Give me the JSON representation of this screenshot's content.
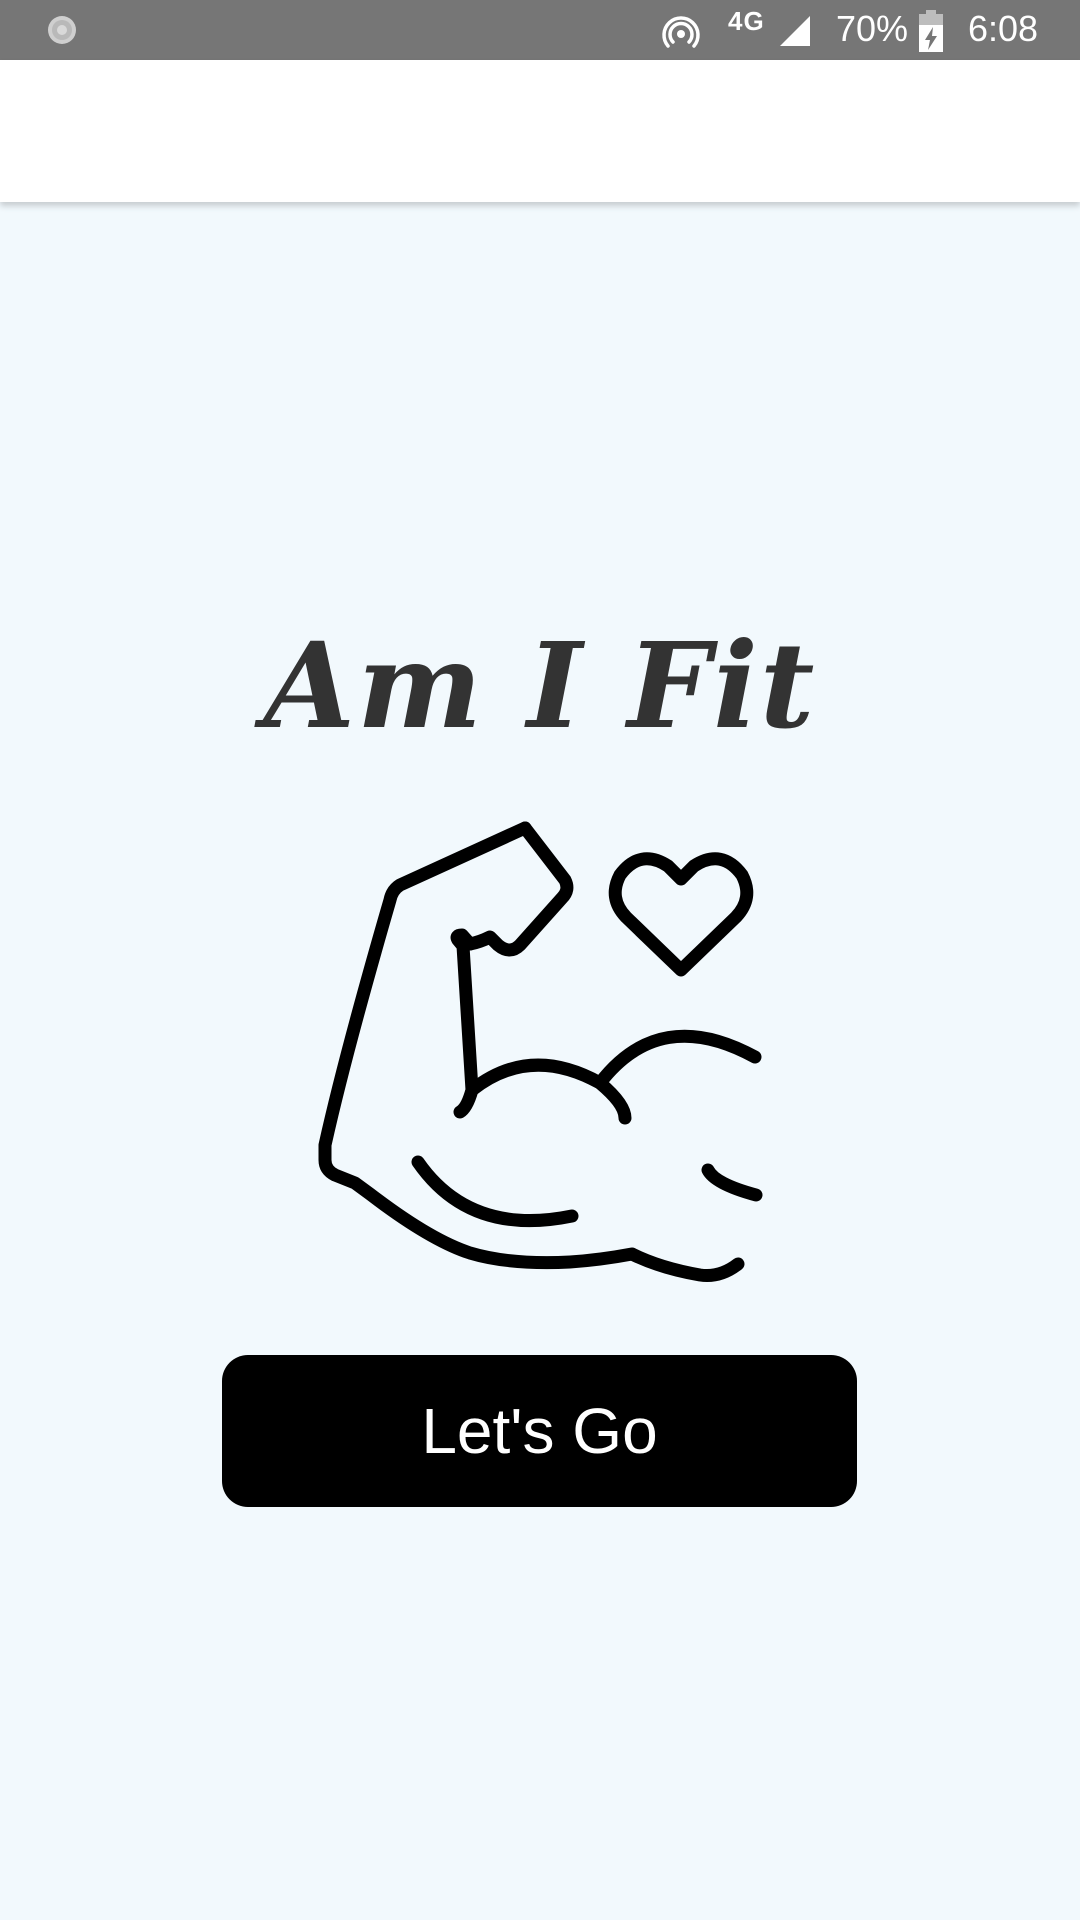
{
  "status_bar": {
    "network_type": "4G",
    "battery_percent": "70%",
    "time": "6:08",
    "icons": {
      "left": "loading-spinner-icon",
      "hotspot": "hotspot-icon",
      "signal": "cellular-signal-icon",
      "battery": "battery-charging-icon"
    },
    "background_color": "#767676"
  },
  "app_bar": {
    "background_color": "#ffffff"
  },
  "main": {
    "title": "Am I Fit",
    "illustration": {
      "icons": [
        "flexed-arm-icon",
        "heart-icon"
      ]
    },
    "primary_button": {
      "label": "Let's Go",
      "background_color": "#000000",
      "text_color": "#ffffff"
    },
    "background_color": "#f2f9fd"
  }
}
